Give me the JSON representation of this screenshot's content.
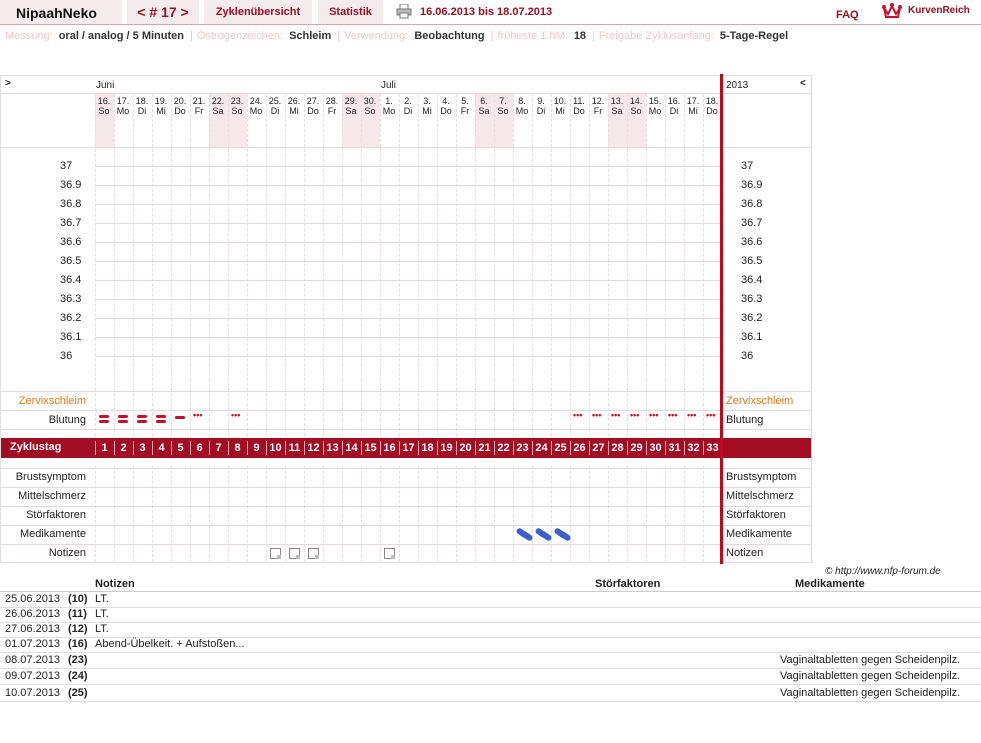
{
  "header": {
    "user": "NipaahNeko",
    "cycle": "< # 17 >",
    "tab_overview": "Zyklenübersicht",
    "tab_stats": "Statistik",
    "date_range": "16.06.2013 bis 18.07.2013",
    "faq": "FAQ",
    "logo_text": "KurvenReich"
  },
  "info": [
    {
      "label": "Messung:",
      "value": "oral / analog / 5 Minuten"
    },
    {
      "label": "Östrogenzeichen:",
      "value": "Schleim"
    },
    {
      "label": "Verwendung:",
      "value": "Beobachtung"
    },
    {
      "label": "früheste 1.hM:",
      "value": "18"
    },
    {
      "label": "Freigabe Zyklusanfang:",
      "value": "5-Tage-Regel"
    }
  ],
  "chart": {
    "nav_left": ">",
    "nav_right": "<",
    "months": [
      "Juni",
      "Juli"
    ],
    "year": "2013",
    "days": [
      {
        "d": "16.",
        "w": "So",
        "we": true
      },
      {
        "d": "17.",
        "w": "Mo"
      },
      {
        "d": "18.",
        "w": "Di"
      },
      {
        "d": "19.",
        "w": "Mi"
      },
      {
        "d": "20.",
        "w": "Do"
      },
      {
        "d": "21.",
        "w": "Fr"
      },
      {
        "d": "22.",
        "w": "Sa",
        "we": true
      },
      {
        "d": "23.",
        "w": "So",
        "we": true
      },
      {
        "d": "24.",
        "w": "Mo"
      },
      {
        "d": "25.",
        "w": "Di"
      },
      {
        "d": "26.",
        "w": "Mi"
      },
      {
        "d": "27.",
        "w": "Do"
      },
      {
        "d": "28.",
        "w": "Fr"
      },
      {
        "d": "29.",
        "w": "Sa",
        "we": true
      },
      {
        "d": "30.",
        "w": "So",
        "we": true
      },
      {
        "d": "1.",
        "w": "Mo"
      },
      {
        "d": "2.",
        "w": "Di"
      },
      {
        "d": "3.",
        "w": "Mi"
      },
      {
        "d": "4.",
        "w": "Do"
      },
      {
        "d": "5.",
        "w": "Fr"
      },
      {
        "d": "6.",
        "w": "Sa",
        "we": true
      },
      {
        "d": "7.",
        "w": "So",
        "we": true
      },
      {
        "d": "8.",
        "w": "Mo"
      },
      {
        "d": "9.",
        "w": "Di"
      },
      {
        "d": "10.",
        "w": "Mi"
      },
      {
        "d": "11.",
        "w": "Do"
      },
      {
        "d": "12.",
        "w": "Fr"
      },
      {
        "d": "13.",
        "w": "Sa",
        "we": true
      },
      {
        "d": "14.",
        "w": "So",
        "we": true
      },
      {
        "d": "15.",
        "w": "Mo"
      },
      {
        "d": "16.",
        "w": "Di"
      },
      {
        "d": "17.",
        "w": "Mi"
      },
      {
        "d": "18.",
        "w": "Do"
      }
    ],
    "temps": [
      "37",
      "36.9",
      "36.8",
      "36.7",
      "36.6",
      "36.5",
      "36.4",
      "36.3",
      "36.2",
      "36.1",
      "36"
    ],
    "row_zervix": "Zervixschleim",
    "row_blutung": "Blutung",
    "row_zyklustag": "Zyklustag",
    "rows_lower": [
      "Brustsymptom",
      "Mittelschmerz",
      "Störfaktoren",
      "Medikamente",
      "Notizen"
    ],
    "bleeding": [
      "heavy",
      "heavy",
      "heavy",
      "heavy",
      "medium",
      "spot",
      "",
      "spot",
      "",
      "",
      "",
      "",
      "",
      "",
      "",
      "",
      "",
      "",
      "",
      "",
      "",
      "",
      "",
      "",
      "",
      "spot",
      "spot",
      "spot",
      "spot",
      "spot",
      "spot",
      "spot",
      "spot"
    ],
    "medication_days": [
      23,
      24,
      25
    ],
    "note_days": [
      10,
      11,
      12,
      16
    ],
    "copyright": "© http://www.nfp-forum.de"
  },
  "notes_table": {
    "headers": [
      "Notizen",
      "Störfaktoren",
      "Medikamente"
    ],
    "rows": [
      {
        "date": "25.06.2013",
        "day": "(10)",
        "note": "LT.",
        "med": ""
      },
      {
        "date": "26.06.2013",
        "day": "(11)",
        "note": "LT.",
        "med": ""
      },
      {
        "date": "27.06.2013",
        "day": "(12)",
        "note": "LT.",
        "med": ""
      },
      {
        "date": "01.07.2013",
        "day": "(16)",
        "note": "Abend-Übelkeit. + Aufstoßen...",
        "med": ""
      },
      {
        "date": "08.07.2013",
        "day": "(23)",
        "note": "",
        "med": "Vaginaltabletten gegen Scheidenpilz."
      },
      {
        "date": "09.07.2013",
        "day": "(24)",
        "note": "",
        "med": "Vaginaltabletten gegen Scheidenpilz."
      },
      {
        "date": "10.07.2013",
        "day": "(25)",
        "note": "",
        "med": "Vaginaltabletten gegen Scheidenpilz."
      }
    ]
  },
  "colors": {
    "accent": "#9a1024",
    "zyklustag_bg": "#a30d23",
    "weekend": "#f6e8ea",
    "pill": "#3a5fd0",
    "bleed": "#c8102e",
    "zervix_label": "#e07a1a"
  }
}
